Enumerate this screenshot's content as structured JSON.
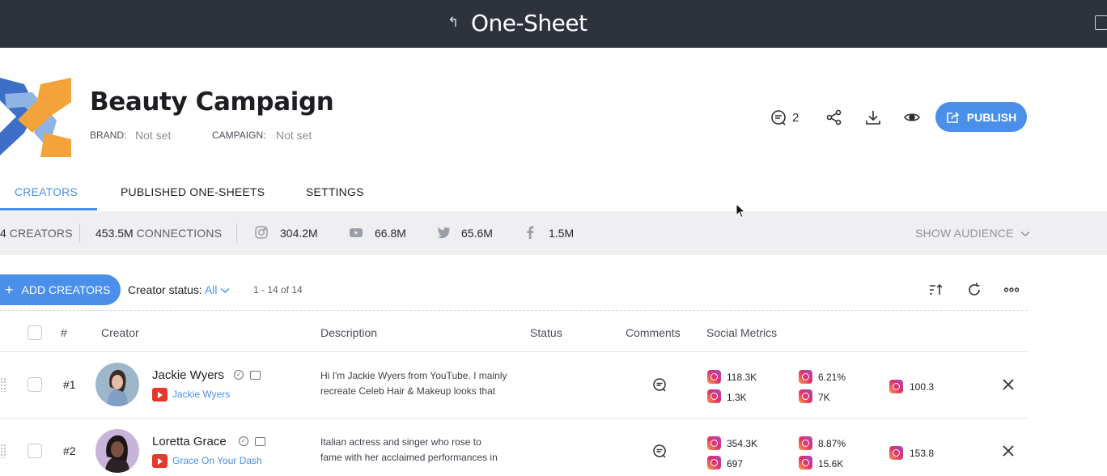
{
  "topbar": {
    "back_glyph": "↰",
    "title": "One-Sheet"
  },
  "header": {
    "campaign_title": "Beauty Campaign",
    "brand_label": "BRAND:",
    "brand_value": "Not set",
    "campaign_label": "CAMPAIGN:",
    "campaign_value": "Not set",
    "comment_count": "2",
    "publish_label": "PUBLISH"
  },
  "tabs": [
    {
      "label": "CREATORS",
      "active": true
    },
    {
      "label": "PUBLISHED ONE-SHEETS",
      "active": false
    },
    {
      "label": "SETTINGS",
      "active": false
    }
  ],
  "stats": {
    "creators_count": "4",
    "creators_label": "CREATORS",
    "connections_value": "453.5M",
    "connections_label": "CONNECTIONS",
    "instagram": "304.2M",
    "youtube": "66.8M",
    "twitter": "65.6M",
    "facebook": "1.5M",
    "show_audience": "SHOW AUDIENCE"
  },
  "toolbar": {
    "add_creators": "ADD CREATORS",
    "status_label": "Creator status:",
    "status_value": "All",
    "range": "1 - 14 of 14"
  },
  "table": {
    "headers": {
      "num": "#",
      "creator": "Creator",
      "description": "Description",
      "status": "Status",
      "comments": "Comments",
      "social": "Social Metrics"
    },
    "rows": [
      {
        "num": "#1",
        "name": "Jackie Wyers",
        "handle": "Jackie Wyers",
        "desc_line1": "Hi I'm Jackie Wyers from YouTube. I mainly",
        "desc_line2": "recreate Celeb Hair & Makeup looks that",
        "m1": "118.3K",
        "m2": "1.3K",
        "m3": "6.21%",
        "m4": "7K",
        "m5": "100.3"
      },
      {
        "num": "#2",
        "name": "Loretta Grace",
        "handle": "Grace On Your Dash",
        "desc_line1": "Italian actress and singer who rose to",
        "desc_line2": "fame with her acclaimed performances in",
        "m1": "354.3K",
        "m2": "697",
        "m3": "8.87%",
        "m4": "15.6K",
        "m5": "153.8"
      }
    ]
  },
  "colors": {
    "accent": "#4a8fe9",
    "topbar": "#2d323d",
    "stats_bg": "#efeff1"
  }
}
